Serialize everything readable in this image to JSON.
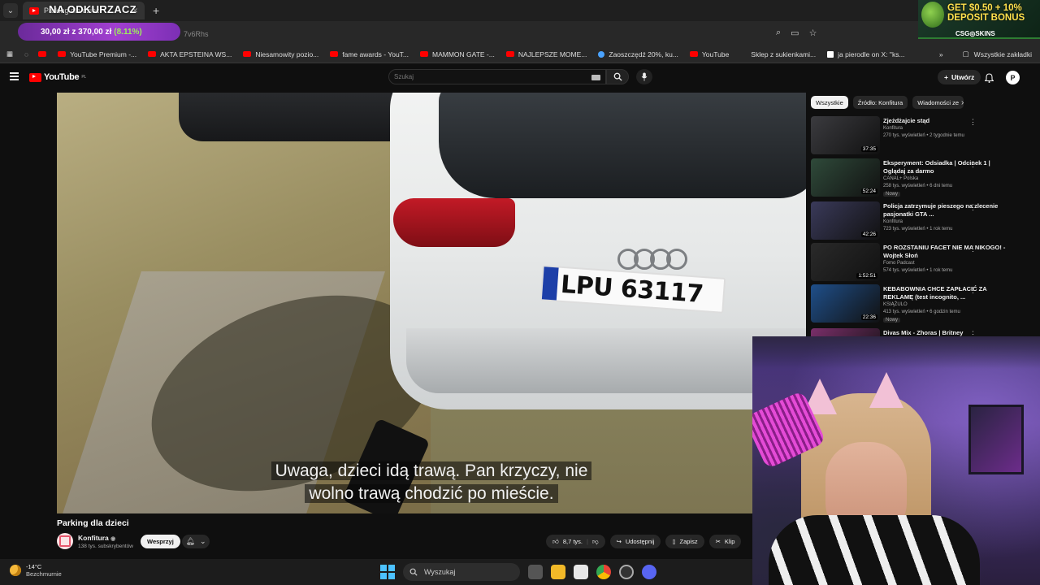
{
  "browser": {
    "tab_title": "Parking dla dzieci",
    "url_fragment": "7v6Rhs",
    "bookmarks": [
      {
        "label": "YouTube Premium -...",
        "icon": "youtube-icon"
      },
      {
        "label": "AKTA EPSTEINA WS...",
        "icon": "youtube-icon"
      },
      {
        "label": "Niesamowity pozio...",
        "icon": "youtube-icon"
      },
      {
        "label": "fame awards - YouT...",
        "icon": "youtube-icon"
      },
      {
        "label": "MAMMON GATE -...",
        "icon": "youtube-icon"
      },
      {
        "label": "NAJLEPSZE MOME...",
        "icon": "youtube-icon"
      },
      {
        "label": "Zaoszczędź 20%, ku...",
        "icon": "bird-icon"
      },
      {
        "label": "YouTube",
        "icon": "youtube-icon"
      },
      {
        "label": "Sklep z sukienkami...",
        "icon": "store-icon"
      },
      {
        "label": "ja pierodle on X: \"ks...",
        "icon": "x-icon"
      }
    ],
    "all_bookmarks_label": "Wszystkie zakładki"
  },
  "overlay": {
    "goal_title": "NA ODKURZACZ",
    "goal_amount": "30,00 zł z 370,00 zł",
    "goal_percent": "(8.11%)",
    "goal_fraction": 0.0811,
    "promo_line1": "GET $0.50 + 10%",
    "promo_line2": "DEPOSIT BONUS",
    "promo_brand": "CSG◎SKINS"
  },
  "youtube": {
    "logo": "YouTube",
    "logo_region": "PL",
    "search_placeholder": "Szukaj",
    "create_label": "Utwórz",
    "avatar_letter": "P"
  },
  "video": {
    "plate_text": "LPU 63117",
    "subtitle_line1": "Uwaga, dzieci idą trawą. Pan krzyczy, nie",
    "subtitle_line2": "wolno trawą chodzić po mieście.",
    "title": "Parking dla dzieci",
    "channel": "Konfitura",
    "subscribers": "138 tys. subskrybentów",
    "support_label": "Wesprzyj",
    "actions": {
      "likes": "8,7 tys.",
      "share": "Udostępnij",
      "save": "Zapisz",
      "clip": "Klip"
    }
  },
  "sidebar": {
    "chips": [
      "Wszystkie",
      "Źródło: Konfitura",
      "Wiadomości ze"
    ],
    "recommendations": [
      {
        "title": "Zjeżdżajcie stąd",
        "channel": "Konfitura",
        "meta": "270 tys. wyświetleń • 2 tygodnie temu",
        "duration": "37:35",
        "badge": "",
        "thumb_color": "#3b3b3f"
      },
      {
        "title": "Eksperyment: Odsiadka | Odcinek 1 | Oglądaj za darmo",
        "channel": "CANAL+ Polska",
        "meta": "258 tys. wyświetleń • 6 dni temu",
        "duration": "52:24",
        "badge": "Nowy",
        "thumb_color": "#2f4a3a"
      },
      {
        "title": "Policja zatrzymuje pieszego na zlecenie pasjonatki GTA ...",
        "channel": "Konfitura",
        "meta": "723 tys. wyświetleń • 1 rok temu",
        "duration": "42:26",
        "badge": "",
        "thumb_color": "#3a3a5a"
      },
      {
        "title": "PO ROZSTANIU FACET NIE MA NIKOGO! - Wojtek Słoń",
        "channel": "Fomo Padcast",
        "meta": "574 tys. wyświetleń • 1 rok temu",
        "duration": "1:52:51",
        "badge": "",
        "thumb_color": "#2a2a2a"
      },
      {
        "title": "KEBABOWNIA CHCE ZAPŁACIĆ ZA REKLAMĘ (test incognito, ...",
        "channel": "KSIĄŻULO",
        "meta": "413 tys. wyświetleń • 6 godzin temu",
        "duration": "22:36",
        "badge": "Nowy",
        "thumb_color": "#1f4f8a"
      },
      {
        "title": "Divas Mix - Zhoras | Britney",
        "channel": "",
        "meta": "",
        "duration": "",
        "badge": "",
        "thumb_color": "#7a2f6a"
      }
    ]
  },
  "taskbar": {
    "temperature": "-14°C",
    "weather": "Bezchmurnie",
    "search_placeholder": "Wyszukaj"
  },
  "colors": {
    "youtube_red": "#ff0000",
    "accent_blue": "#4cc2ff",
    "goal_green": "#9ef05a"
  }
}
